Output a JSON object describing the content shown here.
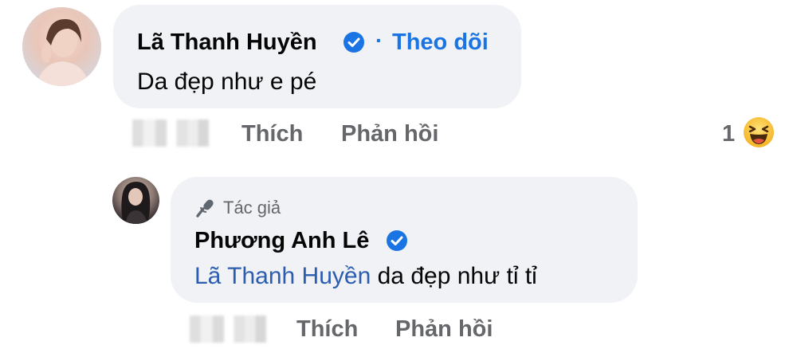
{
  "comment": {
    "author": "Lã Thanh Huyền",
    "separator": "·",
    "follow_label": "Theo dõi",
    "text": "Da đẹp như e pé",
    "actions": {
      "like_label": "Thích",
      "reply_label": "Phản hồi"
    },
    "reaction_count": "1",
    "reaction_icon": "laughing-emoji"
  },
  "reply": {
    "badge_label": "Tác giả",
    "author": "Phương Anh Lê",
    "mention": "Lã Thanh Huyền",
    "text": " da đẹp như tỉ tỉ",
    "actions": {
      "like_label": "Thích",
      "reply_label": "Phản hồi"
    }
  },
  "colors": {
    "bubble": "#f0f2f5",
    "link_blue": "#1b74e4",
    "mention_blue": "#2b5db0",
    "secondary_text": "#65676b"
  }
}
